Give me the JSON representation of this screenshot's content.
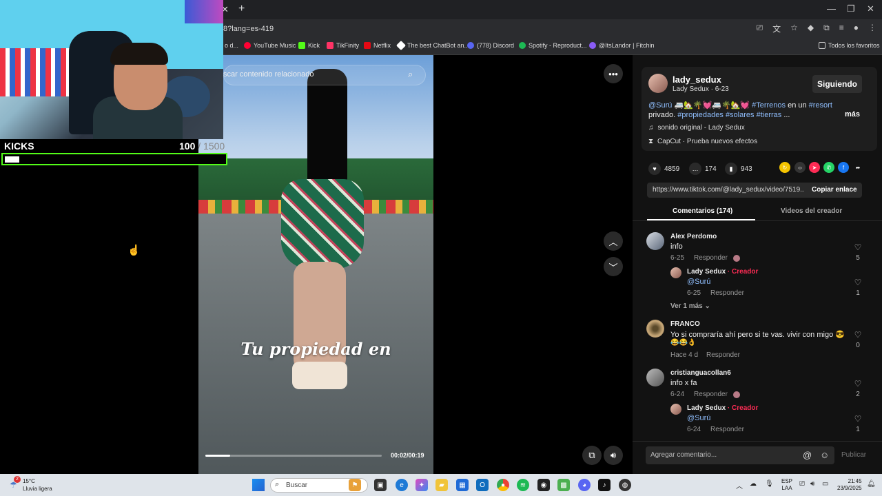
{
  "browser": {
    "url_fragment": "8?lang=es-419",
    "bookmarks": [
      {
        "label": "o d...",
        "color": "#555"
      },
      {
        "label": "YouTube Music",
        "color": "#ff0033"
      },
      {
        "label": "Kick",
        "color": "#53fc18"
      },
      {
        "label": "TikFinity",
        "color": "#ff3366"
      },
      {
        "label": "Netflix",
        "color": "#e50914"
      },
      {
        "label": "The best ChatBot an...",
        "color": "#ffffff"
      },
      {
        "label": "(778) Discord",
        "color": "#5865f2"
      },
      {
        "label": "Spotify - Reproduct...",
        "color": "#1db954"
      },
      {
        "label": "@ItsLandor | Fitchin",
        "color": "#8a5cf6"
      },
      {
        "label": "Todos los favoritos",
        "color": "#888"
      }
    ]
  },
  "overlay": {
    "kicks_label": "KICKS",
    "kicks_current": "100",
    "kicks_goal": "/ 1500",
    "progress": 0.0667
  },
  "video": {
    "search_placeholder": "scar contenido relacionado",
    "caption": "Tu propiedad en",
    "time": "00:02/00:19",
    "progress": 0.14
  },
  "post": {
    "username": "lady_sedux",
    "subline": "Lady Sedux · 6-23",
    "follow_label": "Siguiendo",
    "desc_parts": [
      {
        "t": "@Surú",
        "tag": true
      },
      {
        "t": " 🚐🏡🌴💓🚐🌴🏡💓 ",
        "tag": false
      },
      {
        "t": "#Terrenos",
        "tag": true
      },
      {
        "t": " en un ",
        "tag": false
      },
      {
        "t": "#resort",
        "tag": true
      },
      {
        "t": " privado. ",
        "tag": false
      },
      {
        "t": "#propiedades",
        "tag": true
      },
      {
        "t": " ",
        "tag": false
      },
      {
        "t": "#solares",
        "tag": true
      },
      {
        "t": " ",
        "tag": false
      },
      {
        "t": "#tierras",
        "tag": true
      },
      {
        "t": " ...",
        "tag": false
      }
    ],
    "more_label": "más",
    "sound": "sonido original - Lady Sedux",
    "capcut": "CapCut · Prueba nuevos efectos",
    "likes": "4859",
    "comments": "174",
    "saves": "943",
    "link": "https://www.tiktok.com/@lady_sedux/video/7519...",
    "copy_label": "Copiar enlace",
    "tab_comments": "Comentarios (174)",
    "tab_videos": "Videos del creador",
    "comment_placeholder": "Agregar comentario...",
    "publish_label": "Publicar"
  },
  "comments": [
    {
      "name": "Alex Perdomo",
      "text": "info",
      "date": "6-25",
      "reply": "Responder",
      "likes": "5"
    },
    {
      "name": "Lady Sedux",
      "creator": "· Creador",
      "text": "@Surú",
      "date": "6-25",
      "reply": "Responder",
      "likes": "1"
    },
    {
      "more": "Ver 1 más"
    },
    {
      "name": "FRANCO",
      "text": "Yo si compraría ahí pero si te vas. vivir con migo 😎",
      "text2": "😂😂👌",
      "date": "Hace 4 d",
      "reply": "Responder",
      "likes": "0"
    },
    {
      "name": "cristianguacollan6",
      "text": "info x fa",
      "date": "6-24",
      "reply": "Responder",
      "likes": "2"
    },
    {
      "name": "Lady Sedux",
      "creator": "· Creador",
      "text": "@Surú",
      "date": "6-24",
      "reply": "Responder",
      "likes": "1"
    }
  ],
  "taskbar": {
    "weather_temp": "15°C",
    "weather_desc": "Lluvia ligera",
    "weather_badge": "2",
    "search_label": "Buscar",
    "lang_1": "ESP",
    "lang_2": "LAA",
    "time": "21:45",
    "date": "23/9/2025"
  }
}
